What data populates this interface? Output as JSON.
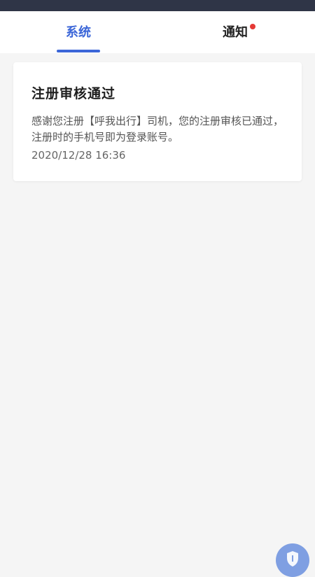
{
  "tabs": [
    {
      "label": "系统",
      "active": true
    },
    {
      "label": "通知",
      "has_unread": true
    }
  ],
  "message": {
    "title": "注册审核通过",
    "body": "感谢您注册【呼我出行】司机，您的注册审核已通过，注册时的手机号即为登录账号。",
    "time": "2020/12/28 16:36"
  },
  "colors": {
    "accent": "#3b66d8",
    "unread_dot": "#e53935",
    "status_bar": "#2f3547"
  },
  "icons": {
    "float_button": "shield-icon"
  }
}
